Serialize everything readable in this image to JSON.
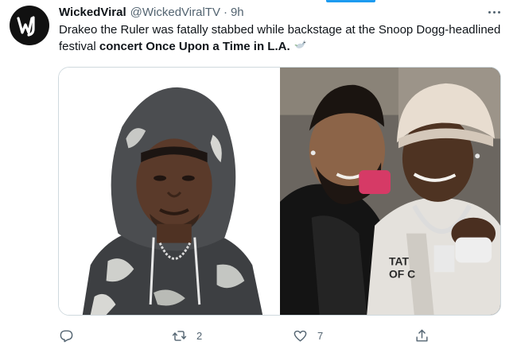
{
  "tweet": {
    "display_name": "WickedViral",
    "handle": "@WickedViralTV",
    "separator": "·",
    "time": "9h",
    "avatar_initials": "W",
    "text_plain": "Drakeo the Ruler was fatally stabbed while backstage at the Snoop Dogg-headlined festival ",
    "text_bold": "concert Once Upon a Time in L.A.",
    "emoji": "dove-emoji"
  },
  "media": {
    "left_photo": "portrait of man in camouflage hoodie",
    "right_photo": "two men smiling at an event"
  },
  "actions": {
    "reply": {
      "icon": "reply-icon",
      "count": ""
    },
    "retweet": {
      "icon": "retweet-icon",
      "count": "2"
    },
    "like": {
      "icon": "heart-icon",
      "count": "7"
    },
    "share": {
      "icon": "share-icon",
      "count": ""
    }
  },
  "colors": {
    "accent": "#1d9bf0",
    "secondary_text": "#536471",
    "primary_text": "#0f1419"
  }
}
